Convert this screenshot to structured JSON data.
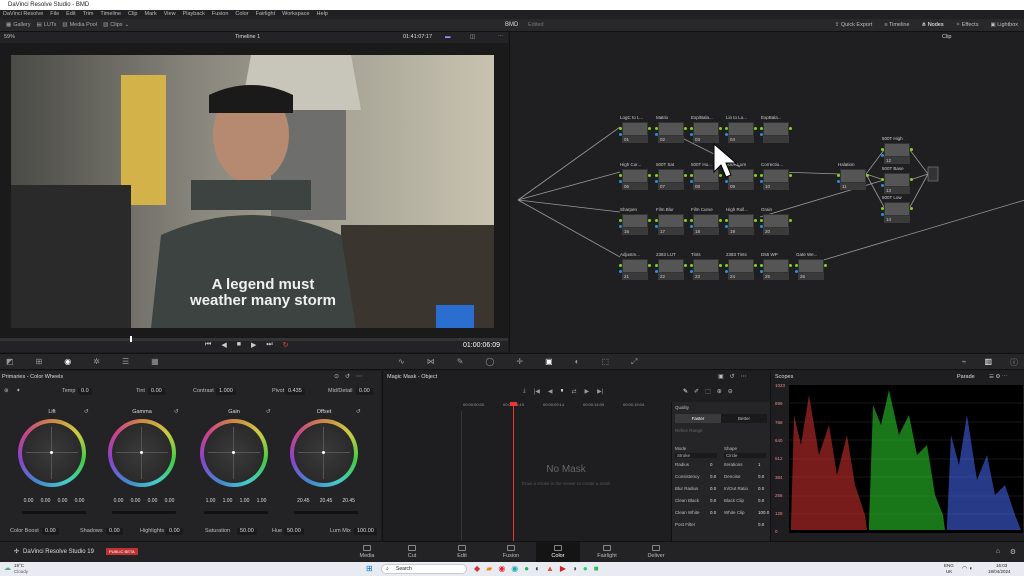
{
  "app": {
    "title": "DaVinci Resolve Studio - BMD"
  },
  "menu": [
    "DaVinci Resolve",
    "File",
    "Edit",
    "Trim",
    "Timeline",
    "Clip",
    "Mark",
    "View",
    "Playback",
    "Fusion",
    "Color",
    "Fairlight",
    "Workspace",
    "Help"
  ],
  "toolbar": {
    "left": [
      "Gallery",
      "LUTs",
      "Media Pool",
      "Clips"
    ],
    "project": "BMD",
    "project_status": "Edited",
    "right": [
      "Quick Export",
      "Timeline",
      "Nodes",
      "Effects",
      "Lightbox"
    ]
  },
  "viewer": {
    "zoom": "59%",
    "timeline_name": "Timeline 1",
    "timecode": "01:41:07:17",
    "playhead_tc": "01:00:06:09",
    "shirt_text": "A legend must weather many storm"
  },
  "nodes_panel": {
    "mode": "Clip"
  },
  "nodes": [
    {
      "label": "LogC to L...",
      "num": "01"
    },
    {
      "label": "Matrix",
      "num": "02"
    },
    {
      "label": "Exp/Bala...",
      "num": "03"
    },
    {
      "label": "Lin to Lo...",
      "num": "04"
    },
    {
      "label": "ExpBala...",
      "num": ""
    },
    {
      "label": "High Cur...",
      "num": "06"
    },
    {
      "label": "500T Sat",
      "num": "07"
    },
    {
      "label": "500T Hu...",
      "num": "08"
    },
    {
      "label": "500T Lum",
      "num": "09"
    },
    {
      "label": "Correctio...",
      "num": "10"
    },
    {
      "label": "Sharpen",
      "num": "16"
    },
    {
      "label": "Film Blur",
      "num": "17"
    },
    {
      "label": "Film Curve",
      "num": "18"
    },
    {
      "label": "High Roll...",
      "num": "19"
    },
    {
      "label": "Grain",
      "num": "20"
    },
    {
      "label": "Adjustm...",
      "num": "21"
    },
    {
      "label": "2383 LUT",
      "num": "22"
    },
    {
      "label": "Tints",
      "num": "23"
    },
    {
      "label": "2383 Tints",
      "num": "24"
    },
    {
      "label": "D55 WP",
      "num": "25"
    },
    {
      "label": "Gate We...",
      "num": "26"
    },
    {
      "label": "Halation",
      "num": "11"
    },
    {
      "label": "500T High",
      "num": "12"
    },
    {
      "label": "500T Base",
      "num": "13"
    },
    {
      "label": "500T Low",
      "num": "14"
    }
  ],
  "primaries": {
    "title": "Primaries - Color Wheels",
    "temp_label": "Temp",
    "temp": "0.0",
    "tint_label": "Tint",
    "tint": "0.00",
    "contrast_label": "Contrast",
    "contrast": "1.000",
    "pivot_label": "Pivot",
    "pivot": "0.435",
    "middetail_label": "Mid/Detail",
    "middetail": "0.00",
    "wheels": [
      {
        "name": "Lift",
        "vals": [
          "0.00",
          "0.00",
          "0.00",
          "0.00"
        ]
      },
      {
        "name": "Gamma",
        "vals": [
          "0.00",
          "0.00",
          "0.00",
          "0.00"
        ]
      },
      {
        "name": "Gain",
        "vals": [
          "1.00",
          "1.00",
          "1.00",
          "1.00"
        ]
      },
      {
        "name": "Offset",
        "vals": [
          "20.45",
          "20.45",
          "20.45"
        ]
      }
    ],
    "bottom": [
      {
        "label": "Color Boost",
        "value": "0.00"
      },
      {
        "label": "Shadows",
        "value": "0.00"
      },
      {
        "label": "Highlights",
        "value": "0.00"
      },
      {
        "label": "Saturation",
        "value": "50.00"
      },
      {
        "label": "Hue",
        "value": "50.00"
      },
      {
        "label": "Lum Mix",
        "value": "100.00"
      }
    ]
  },
  "magic_mask": {
    "title": "Magic Mask - Object",
    "ruler": [
      "00:00:00:00",
      "00:00:04:19",
      "00:00:09:14",
      "00:00:14:09",
      "00:00:19:04"
    ],
    "empty_title": "No Mask",
    "empty_hint": "Draw a stroke in the viewer to create a mask",
    "quality_label": "Quality",
    "quality_faster": "Faster",
    "quality_better": "Better",
    "refine": "Refine Range",
    "mode_label": "Mode",
    "mode_value": "Stroke",
    "shape_label": "Shape",
    "shape_value": "Circle",
    "params": [
      {
        "l": "Radius",
        "v": "0",
        "l2": "Iterations",
        "v2": "1"
      },
      {
        "l": "Consistency",
        "v": "0.0",
        "l2": "Denoise",
        "v2": "0.0"
      },
      {
        "l": "Blur Radius",
        "v": "0.0",
        "l2": "In/Out Ratio",
        "v2": "0.0"
      },
      {
        "l": "Clean Black",
        "v": "0.0",
        "l2": "Black Clip",
        "v2": "0.0"
      },
      {
        "l": "Clean White",
        "v": "0.0",
        "l2": "White Clip",
        "v2": "100.0"
      },
      {
        "l": "Post Filter",
        "v": "",
        "l2": "",
        "v2": "0.0"
      }
    ]
  },
  "scopes": {
    "title": "Scopes",
    "mode": "Parade",
    "ticks": [
      "1023",
      "896",
      "768",
      "640",
      "512",
      "384",
      "256",
      "128",
      "0"
    ]
  },
  "brand": {
    "name": "DaVinci Resolve Studio 19",
    "badge": "PUBLIC BETA"
  },
  "pages": [
    "Media",
    "Cut",
    "Edit",
    "Fusion",
    "Color",
    "Fairlight",
    "Deliver"
  ],
  "active_page": "Color",
  "taskbar": {
    "weather_temp": "19°C",
    "weather_desc": "Cloudy",
    "search": "Search",
    "lang": "ENG",
    "region": "UK",
    "time": "16:03",
    "date": "18/04/2024"
  }
}
